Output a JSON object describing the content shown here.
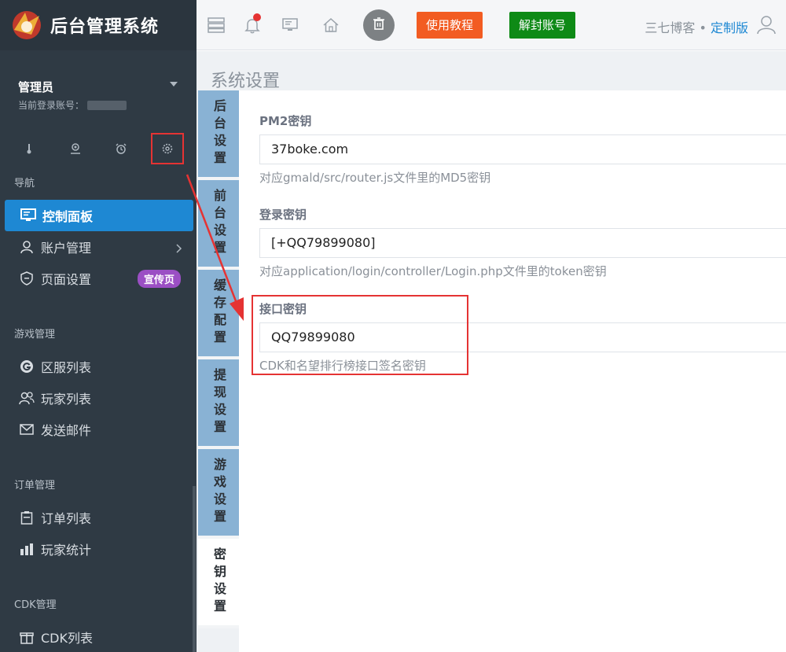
{
  "brand": {
    "title": "后台管理系统"
  },
  "user": {
    "name": "管理员",
    "account_label": "当前登录账号："
  },
  "quick_icons": [
    "thermometer-icon",
    "user-pin-icon",
    "alarm-clock-icon",
    "settings-gear-icon"
  ],
  "sidebar": {
    "nav_section": "导航",
    "nav_items": [
      {
        "label": "控制面板",
        "active": true
      },
      {
        "label": "账户管理"
      },
      {
        "label": "页面设置",
        "badge": "宣传页"
      }
    ],
    "game_section": "游戏管理",
    "game_items": [
      {
        "label": "区服列表"
      },
      {
        "label": "玩家列表"
      },
      {
        "label": "发送邮件"
      }
    ],
    "order_section": "订单管理",
    "order_items": [
      {
        "label": "订单列表"
      },
      {
        "label": "玩家统计"
      }
    ],
    "cdk_section": "CDK管理",
    "cdk_items": [
      {
        "label": "CDK列表"
      }
    ]
  },
  "header": {
    "tutorial_label": "使用教程",
    "unban_label": "解封账号",
    "site_name": "三七博客",
    "separator": " • ",
    "edition": "定制版"
  },
  "content": {
    "page_title": "系统设置",
    "tabs": [
      "后台设置",
      "前台设置",
      "缓存配置",
      "提现设置",
      "游戏设置",
      "密钥设置"
    ],
    "active_tab": 5,
    "fields": [
      {
        "label": "PM2密钥",
        "value": "37boke.com",
        "help": "对应gmald/src/router.js文件里的MD5密钥"
      },
      {
        "label": "登录密钥",
        "value": "[+QQ79899080]",
        "help": "对应application/login/controller/Login.php文件里的token密钥"
      },
      {
        "label": "接口密钥",
        "value": "QQ79899080",
        "help": "CDK和名望排行榜接口签名密钥"
      }
    ]
  },
  "colors": {
    "sidebar_bg": "#2f3a44",
    "active_nav": "#1e88d3",
    "tutorial_btn": "#f25c22",
    "unban_btn": "#0e8a16",
    "badge": "#9b4fc4",
    "highlight": "#e53333",
    "tab_bg": "#89b2d4"
  }
}
